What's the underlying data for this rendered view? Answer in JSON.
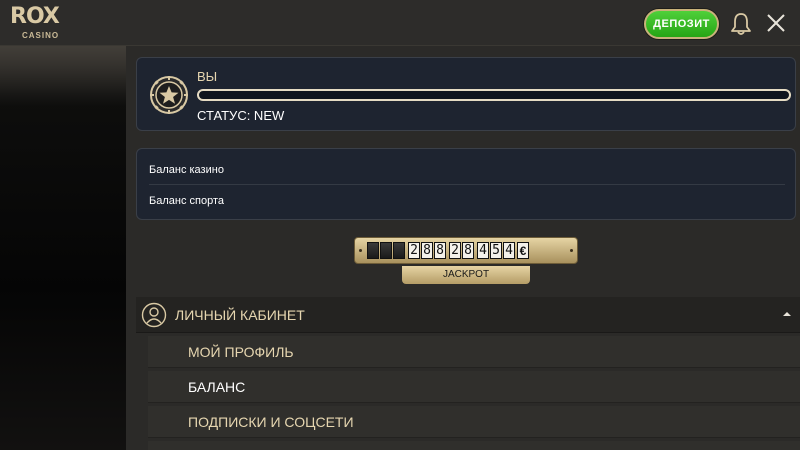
{
  "header": {
    "logo_main": "ROX",
    "logo_sub": "CASINO",
    "deposit_label": "ДЕПОЗИТ"
  },
  "profile": {
    "name": "ВЫ",
    "status": "СТАТУС: NEW",
    "progress_fraction": 0
  },
  "balances": {
    "casino_label": "Баланс казино",
    "sport_label": "Баланс спорта"
  },
  "jackpot": {
    "digits": [
      "",
      "",
      "",
      "2",
      "8",
      "8",
      "2",
      "8",
      "4",
      "5",
      "4"
    ],
    "currency": "€",
    "label": "JACKPOT"
  },
  "menu": {
    "section_label": "ЛИЧНЫЙ КАБИНЕТ",
    "items": [
      {
        "label": "МОЙ ПРОФИЛЬ"
      },
      {
        "label": "БАЛАНС"
      },
      {
        "label": "ПОДПИСКИ И СОЦСЕТИ"
      }
    ]
  },
  "colors": {
    "accent_gold": "#d9c9a4",
    "deposit_green": "#2fb51f",
    "card_bg": "#1e2430"
  },
  "icons": {
    "bell": "bell-icon",
    "close": "close-icon",
    "avatar": "poker-chip-star-icon",
    "user": "user-circle-icon",
    "collapse": "chevron-up-icon"
  }
}
